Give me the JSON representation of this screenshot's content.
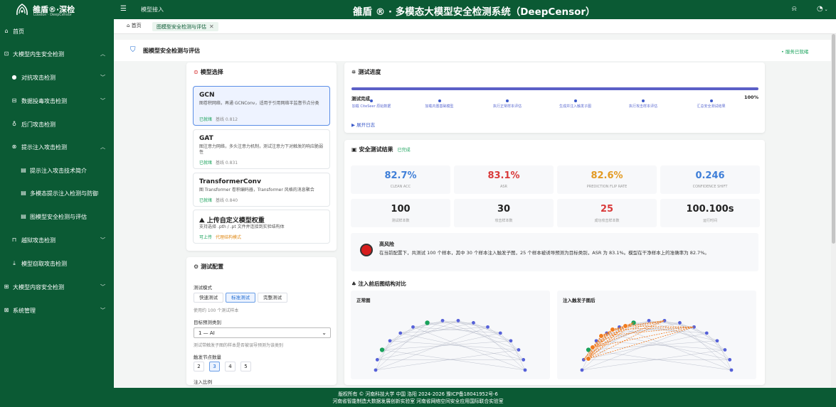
{
  "header": {
    "logo_title": "雒盾®·深检",
    "logo_subtitle": "Luodun · DeepCensor",
    "menu_icon": "menu-icon",
    "model_access_link": "模型接入",
    "app_title": "雒盾 ® · 多模态大模型安全检测系统（DeepCensor）"
  },
  "sidebar": {
    "items": [
      {
        "label": "首页",
        "icon": "home-icon"
      },
      {
        "label": "大模型内生安全检测",
        "icon": "lock-icon",
        "expanded": true
      },
      {
        "label": "对抗攻击检测",
        "icon": "target-icon"
      },
      {
        "label": "数据投毒攻击检测",
        "icon": "database-icon"
      },
      {
        "label": "后门攻击检测",
        "icon": "key-icon"
      },
      {
        "label": "提示注入攻击检测",
        "icon": "inject-icon",
        "expanded": true
      },
      {
        "label": "提示注入攻击技术简介",
        "icon": "doc-icon"
      },
      {
        "label": "多模态提示注入检测与防御",
        "icon": "doc-icon"
      },
      {
        "label": "图模型安全检测与评估",
        "icon": "doc-icon"
      },
      {
        "label": "越狱攻击检测",
        "icon": "unlock-icon"
      },
      {
        "label": "模型窃取攻击检测",
        "icon": "download-icon"
      },
      {
        "label": "大模型内容安全检测",
        "icon": "shield-icon"
      },
      {
        "label": "系统管理",
        "icon": "settings-icon"
      }
    ]
  },
  "tabs": {
    "home": "首页",
    "current": "图模型安全检测与评估"
  },
  "page": {
    "title": "图模型安全检测与评估",
    "status": "• 服务已就绪"
  },
  "model_select": {
    "title": "模型选择",
    "models": [
      {
        "name": "GCN",
        "desc": "图卷积网络，再通 GCNConv，适用于引用网络半监督节点分类",
        "status": "已就绪",
        "baseline": "基线 0.812"
      },
      {
        "name": "GAT",
        "desc": "图注意力网络，多头注意力机制，测试注意力下对触发的响应脆弱性",
        "status": "已就绪",
        "baseline": "基线 0.831"
      },
      {
        "name": "TransformerConv",
        "desc": "图 Transformer 卷积编码器，Transformer 风格的消息聚合",
        "status": "已就绪",
        "baseline": "基线 0.840"
      }
    ],
    "upload": {
      "title": "上传自定义模型权重",
      "desc": "支持选择 .pth / .pt 文件并连接到实验结构体",
      "status": "可上传",
      "hint": "代理结构模式"
    }
  },
  "test_config": {
    "title": "测试配置",
    "mode_label": "测试模式",
    "modes": [
      "快速测试",
      "标准测试",
      "完整测试"
    ],
    "selected_mode": "标准测试",
    "mode_hint": "使用约 100 个测试样本",
    "target_label": "目标预测类别",
    "target_value": "1 — AI",
    "target_hint": "测试带触发子图的样本是否被误导预测为该类别",
    "trigger_label": "触发节点数量",
    "trigger_options": [
      "2",
      "3",
      "4",
      "5"
    ],
    "trigger_selected": "3",
    "next_label": "注入比例"
  },
  "progress": {
    "title": "测试进度",
    "status": "测试完成",
    "percent_text": "100%",
    "fraction": 1.0,
    "steps": [
      "加载 CiteSeer 原始数据",
      "加载内置基础模型",
      "执行正常样本评估",
      "生成并注入触发子图",
      "执行攻击样本评估",
      "汇总安全测试结果"
    ],
    "expand_log": "▶ 展开日志"
  },
  "results": {
    "title": "安全测试结果",
    "badge": "已完成",
    "metrics": [
      {
        "value": "82.7%",
        "label": "CLEAN ACC",
        "color": "#3f7fd8"
      },
      {
        "value": "83.1%",
        "label": "ASR",
        "color": "#d93a3a"
      },
      {
        "value": "82.6%",
        "label": "PREDICTION FLIP RATE",
        "color": "#e39a22"
      },
      {
        "value": "0.246",
        "label": "CONFIDENCE SHIFT",
        "color": "#3f7fd8"
      },
      {
        "value": "100",
        "label": "测试样本数",
        "color": "#222222"
      },
      {
        "value": "30",
        "label": "攻击样本数",
        "color": "#222222"
      },
      {
        "value": "25",
        "label": "成功攻击样本数",
        "color": "#d93a3a"
      },
      {
        "value": "100.100s",
        "label": "运行时间",
        "color": "#222222"
      }
    ],
    "risk_title": "高风险",
    "risk_desc": "在当前配置下，共测试 100 个样本，其中 30 个样本注入触发子图，25 个样本被诱导预测为目标类别，ASR 为 83.1%。模型在干净样本上的准确率为 82.7%。"
  },
  "graph_compare": {
    "title": "注入前后图结构对比",
    "normal_title": "正常图",
    "injected_title": "注入触发子图后"
  },
  "footer": {
    "line1": "版权所有 © 河南科技大学  中国 洛阳  2024-2026   豫ICP备18041952号-6",
    "line2": "河南省智能制造大数据发展创新实验室  河南省网络空间安全应用国际联合实验室"
  },
  "colors": {
    "brand": "#0b5a34",
    "accent": "#5b5fc7",
    "danger": "#d71d1d",
    "trigger": "#f07b1e",
    "node": "#5560d8"
  }
}
